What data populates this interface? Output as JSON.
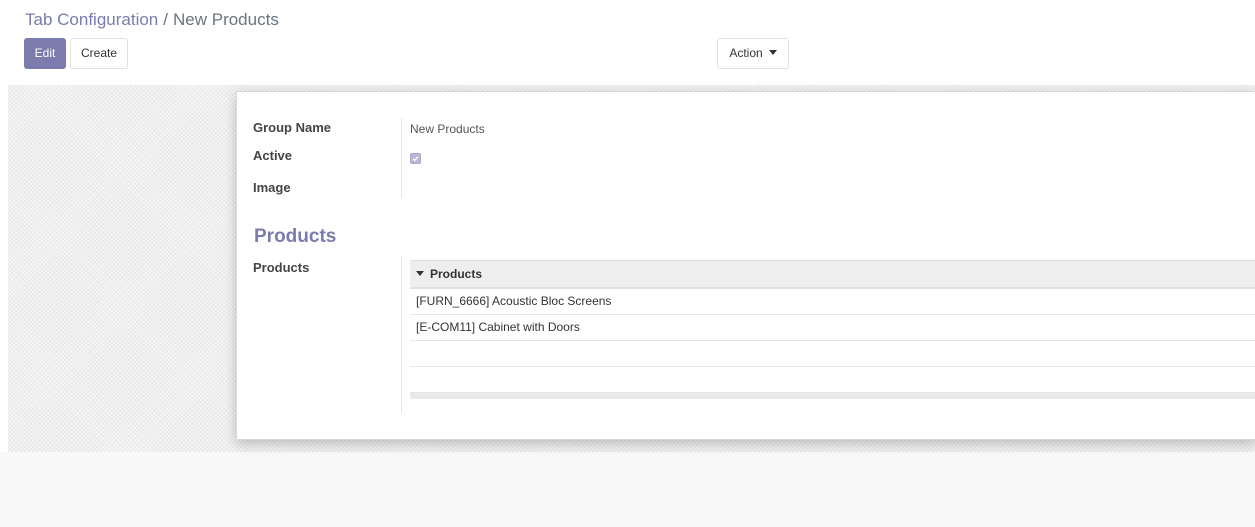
{
  "breadcrumb": {
    "parent": "Tab Configuration",
    "separator": "/",
    "current": "New Products"
  },
  "buttons": {
    "edit": "Edit",
    "create": "Create",
    "action": "Action"
  },
  "form": {
    "group_name_label": "Group Name",
    "group_name_value": "New Products",
    "active_label": "Active",
    "active_checked": true,
    "image_label": "Image",
    "section_title": "Products",
    "products_label": "Products",
    "products_table": {
      "header": "Products",
      "rows": [
        "[FURN_6666] Acoustic Bloc Screens",
        "[E-COM11] Cabinet with Doors"
      ]
    }
  },
  "colors": {
    "accent": "#7c7bad"
  },
  "icons": {
    "dropdown": "caret-down-icon",
    "checkmark": "check-icon"
  }
}
